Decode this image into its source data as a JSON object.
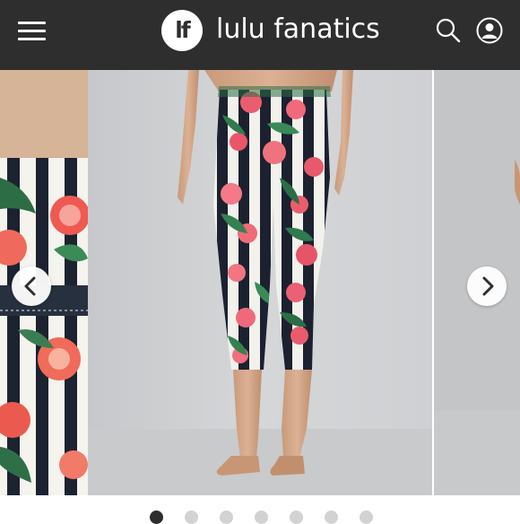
{
  "header": {
    "menu_icon": "hamburger-menu-icon",
    "logo_text": "lf",
    "brand_name": "lulu fanatics",
    "search_icon": "search-icon",
    "account_icon": "user-account-icon",
    "background_color": "#2e2e2e"
  },
  "gallery": {
    "prev_icon": "chevron-left-icon",
    "next_icon": "chevron-right-icon",
    "slide_count": 7,
    "active_slide_index": 0
  },
  "colors": {
    "dot_active": "#2e2e2e",
    "dot_inactive": "#d2d2d2",
    "backdrop": "#d0d1d3"
  }
}
